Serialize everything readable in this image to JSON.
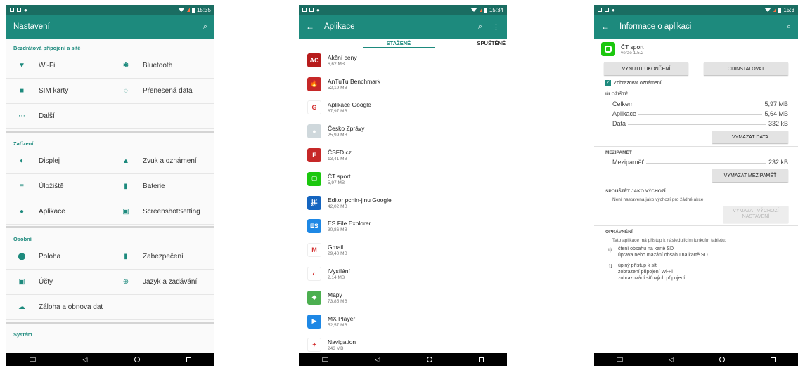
{
  "status": {
    "time1": "15:35",
    "time2": "15:34",
    "time3": "15:3"
  },
  "settings": {
    "title": "Nastavení",
    "sections": [
      {
        "title": "Bezdrátová připojení a sítě",
        "items": [
          {
            "label": "Wi-Fi",
            "icon": "wifi-icon",
            "glyph": "▼"
          },
          {
            "label": "Bluetooth",
            "icon": "bluetooth-icon",
            "glyph": "✱"
          },
          {
            "label": "SIM karty",
            "icon": "sim-icon",
            "glyph": "■"
          },
          {
            "label": "Přenesená data",
            "icon": "data-usage-icon",
            "glyph": "◌"
          },
          {
            "label": "Další",
            "icon": "more-icon",
            "glyph": "⋯"
          }
        ]
      },
      {
        "title": "Zařízení",
        "items": [
          {
            "label": "Displej",
            "icon": "display-icon",
            "glyph": "◐"
          },
          {
            "label": "Zvuk a oznámení",
            "icon": "bell-icon",
            "glyph": "▲"
          },
          {
            "label": "Úložiště",
            "icon": "storage-icon",
            "glyph": "≡"
          },
          {
            "label": "Baterie",
            "icon": "battery-icon",
            "glyph": "▮"
          },
          {
            "label": "Aplikace",
            "icon": "android-icon",
            "glyph": "●"
          },
          {
            "label": "ScreenshotSetting",
            "icon": "image-icon",
            "glyph": "▣"
          }
        ]
      },
      {
        "title": "Osobní",
        "items": [
          {
            "label": "Poloha",
            "icon": "location-icon",
            "glyph": "⬤"
          },
          {
            "label": "Zabezpečení",
            "icon": "lock-icon",
            "glyph": "▮"
          },
          {
            "label": "Účty",
            "icon": "account-icon",
            "glyph": "▣"
          },
          {
            "label": "Jazyk a zadávání",
            "icon": "globe-icon",
            "glyph": "⊕"
          },
          {
            "label": "Záloha a obnova dat",
            "icon": "cloud-icon",
            "glyph": "☁"
          }
        ]
      },
      {
        "title": "Systém",
        "items": []
      }
    ]
  },
  "apps": {
    "title": "Aplikace",
    "tabs": [
      "STAŽENÉ",
      "SPUŠTĚNÉ"
    ],
    "list": [
      {
        "name": "Akční ceny",
        "size": "6,62 MB",
        "color": "#b71c1c",
        "glyph": "AC"
      },
      {
        "name": "AnTuTu Benchmark",
        "size": "52,19 MB",
        "color": "#c62828",
        "glyph": "🔥"
      },
      {
        "name": "Aplikace Google",
        "size": "87,97 MB",
        "color": "#ffffff",
        "glyph": "G"
      },
      {
        "name": "Česko Zprávy",
        "size": "25,99 MB",
        "color": "#cfd8dc",
        "glyph": "●"
      },
      {
        "name": "ČSFD.cz",
        "size": "13,41 MB",
        "color": "#c62828",
        "glyph": "F"
      },
      {
        "name": "ČT sport",
        "size": "5,97 MB",
        "color": "#1bc70e",
        "glyph": "▢"
      },
      {
        "name": "Editor pchin-jinu Google",
        "size": "42,02 MB",
        "color": "#1565c0",
        "glyph": "拼"
      },
      {
        "name": "ES File Explorer",
        "size": "30,86 MB",
        "color": "#1e88e5",
        "glyph": "ES"
      },
      {
        "name": "Gmail",
        "size": "29,40 MB",
        "color": "#ffffff",
        "glyph": "M"
      },
      {
        "name": "iVysílání",
        "size": "2,14 MB",
        "color": "#ffffff",
        "glyph": "◐"
      },
      {
        "name": "Mapy",
        "size": "73,85 MB",
        "color": "#4caf50",
        "glyph": "◆"
      },
      {
        "name": "MX Player",
        "size": "52,57 MB",
        "color": "#1e88e5",
        "glyph": "▶"
      },
      {
        "name": "Navigation",
        "size": "243 MB",
        "color": "#ffffff",
        "glyph": "✦"
      }
    ]
  },
  "info": {
    "title": "Informace o aplikaci",
    "app_name": "ČT sport",
    "version": "verze 1.5.2",
    "force_stop": "VYNUTIT UKONČENÍ",
    "uninstall": "ODINSTALOVAT",
    "show_notifications": "Zobrazovat oznámení",
    "storage_title": "ÚLOŽIŠTĚ",
    "storage": [
      {
        "k": "Celkem",
        "v": "5,97 MB"
      },
      {
        "k": "Aplikace",
        "v": "5,64 MB"
      },
      {
        "k": "Data",
        "v": "332 kB"
      }
    ],
    "clear_data": "VYMAZAT DATA",
    "cache_title": "MEZIPAMĚŤ",
    "cache": {
      "k": "Mezipaměť",
      "v": "232 kB"
    },
    "clear_cache": "VYMAZAT MEZIPAMĚŤ",
    "default_title": "SPOUŠTĚT JAKO VÝCHOZÍ",
    "default_note": "Není nastavena jako výchozí pro žádné akce",
    "clear_defaults": "VYMAZAT VÝCHOZÍ NASTAVENÍ",
    "perm_title": "OPRÁVNĚNÍ",
    "perm_note": "Tato aplikace má přístup k následujícím funkcím tabletu:",
    "perms": [
      {
        "icon": "usb-icon",
        "glyph": "ψ",
        "lines": [
          "čtení obsahu na kartě SD",
          "úprava nebo mazání obsahu na kartě SD"
        ]
      },
      {
        "icon": "network-icon",
        "glyph": "⇅",
        "lines": [
          "úplný přístup k síti",
          "zobrazení připojení Wi-Fi",
          "zobrazování síťových připojení"
        ]
      }
    ]
  }
}
